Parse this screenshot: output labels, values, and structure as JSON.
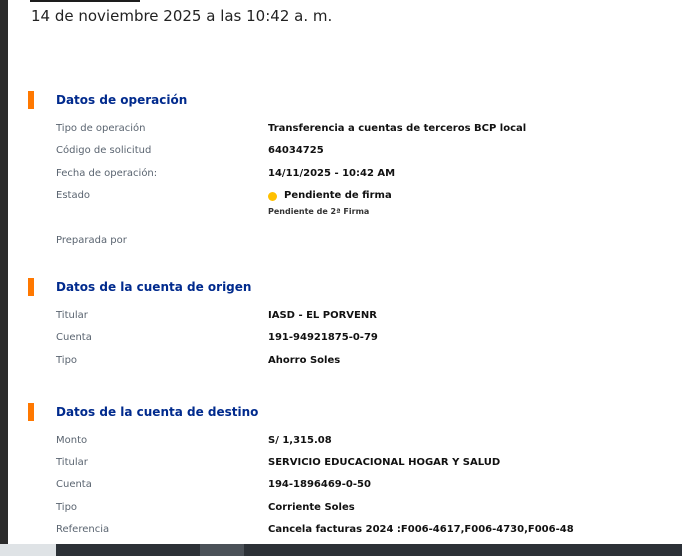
{
  "header": {
    "datetime": "14 de noviembre 2025 a las 10:42 a. m."
  },
  "operacion": {
    "title": "Datos de operación",
    "tipo_label": "Tipo de operación",
    "tipo_value": "Transferencia a cuentas de terceros BCP local",
    "codigo_label": "Código de solicitud",
    "codigo_value": "64034725",
    "fecha_label": "Fecha de operación:",
    "fecha_value": "14/11/2025 - 10:42 AM",
    "estado_label": "Estado",
    "estado_value": "Pendiente de firma",
    "estado_sub": "Pendiente de 2ª Firma",
    "preparada_label": "Preparada por",
    "preparada_value": ""
  },
  "origen": {
    "title": "Datos de la cuenta de origen",
    "titular_label": "Titular",
    "titular_value": "IASD - EL PORVENR",
    "cuenta_label": "Cuenta",
    "cuenta_value": "191-94921875-0-79",
    "tipo_label": "Tipo",
    "tipo_value": "Ahorro Soles"
  },
  "destino": {
    "title": "Datos de la cuenta de destino",
    "monto_label": "Monto",
    "monto_value": "S/ 1,315.08",
    "titular_label": "Titular",
    "titular_value": "SERVICIO EDUCACIONAL HOGAR Y SALUD",
    "cuenta_label": "Cuenta",
    "cuenta_value": "194-1896469-0-50",
    "tipo_label": "Tipo",
    "tipo_value": "Corriente Soles",
    "referencia_label": "Referencia",
    "referencia_value": "Cancela facturas 2024 :F006-4617,F006-4730,F006-48"
  },
  "colors": {
    "accent_bar": "#ff7800",
    "section_title": "#002a8d",
    "status_pending": "#ffc000"
  }
}
